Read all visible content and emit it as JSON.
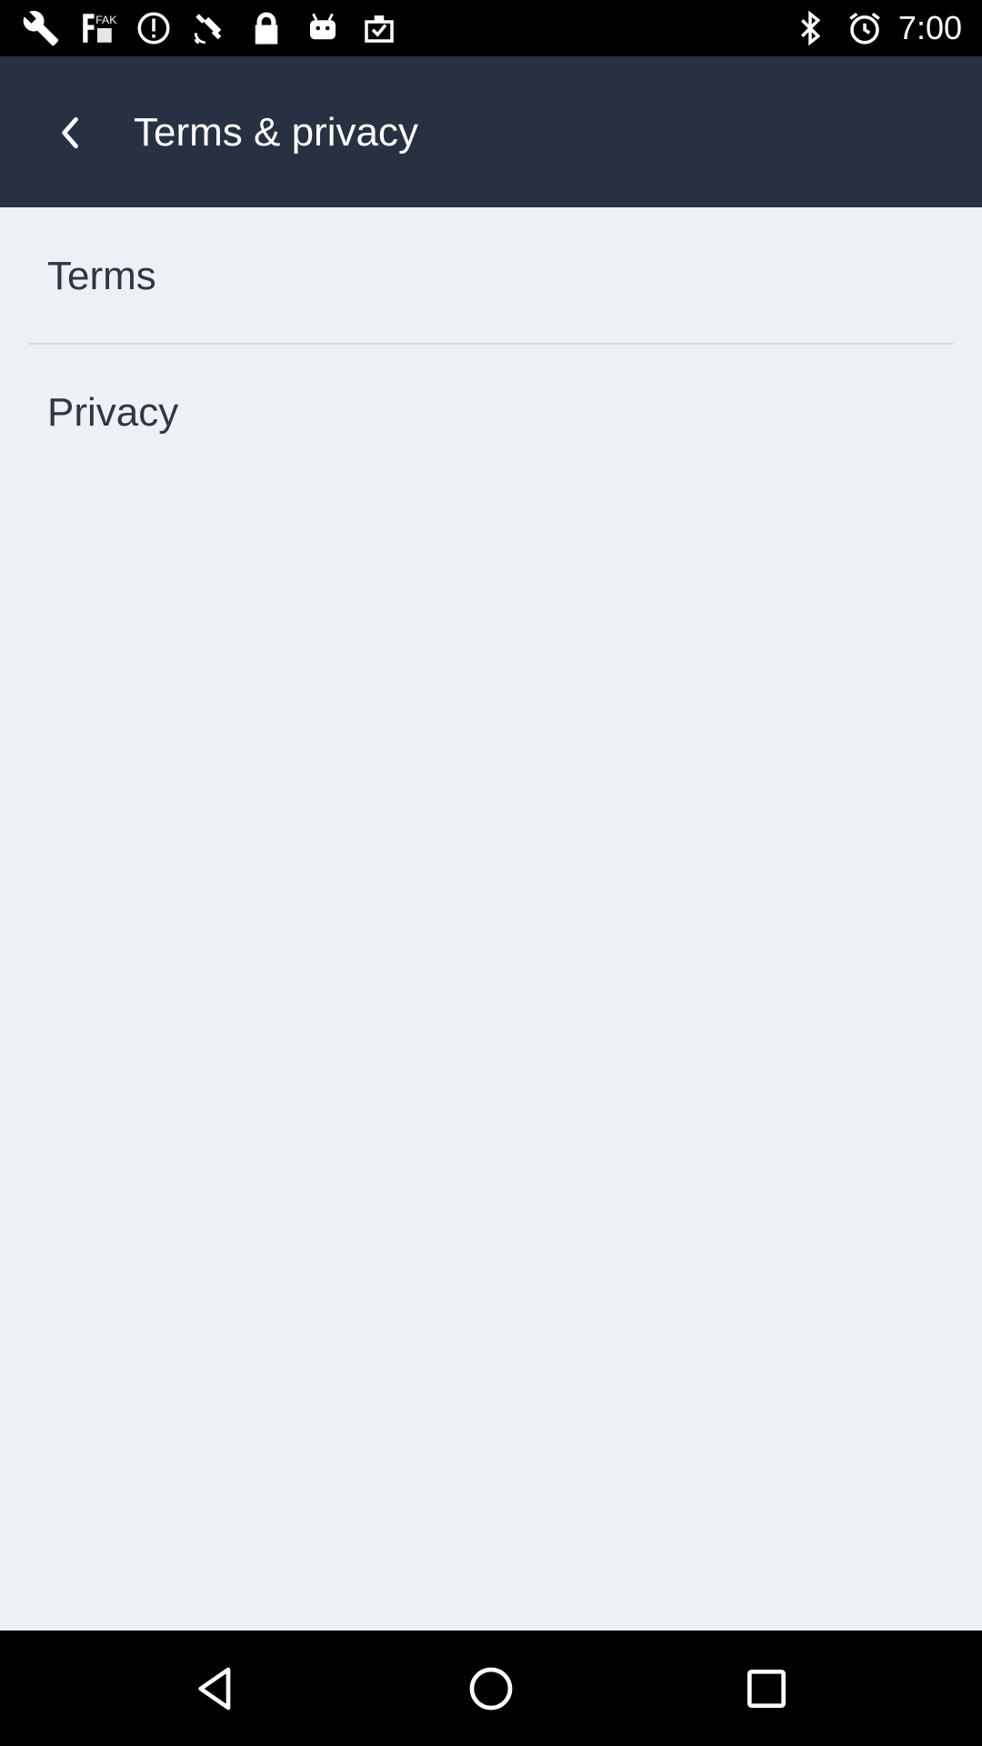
{
  "status_bar": {
    "time": "7:00",
    "left_icons": [
      "wrench-icon",
      "fake-gps-icon",
      "alert-circle-icon",
      "satellite-icon",
      "lock-icon",
      "android-icon",
      "clipboard-check-icon"
    ],
    "right_icons": [
      "bluetooth-icon",
      "alarm-icon"
    ]
  },
  "app_bar": {
    "title": "Terms & privacy",
    "back_icon": "chevron-left-icon",
    "background": "#283142"
  },
  "list": {
    "items": [
      {
        "label": "Terms"
      },
      {
        "label": "Privacy"
      }
    ]
  },
  "nav_bar": {
    "icons": [
      "back-triangle-icon",
      "home-circle-icon",
      "recents-square-icon"
    ]
  },
  "colors": {
    "content_background": "#edf1f5",
    "text": "#2f3644",
    "divider": "#d5dae0"
  }
}
